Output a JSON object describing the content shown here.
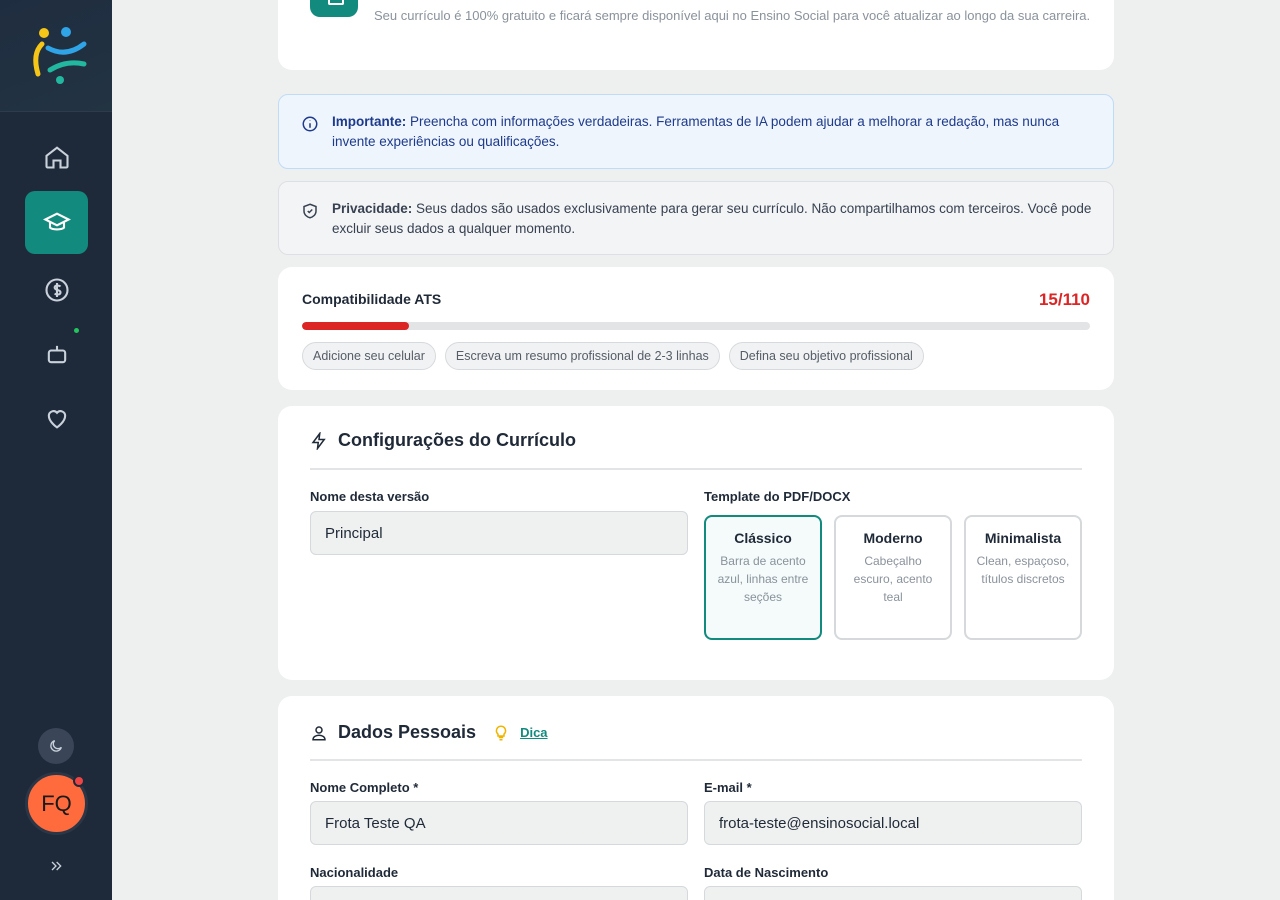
{
  "sidebar": {
    "nav": [
      {
        "icon": "home-icon"
      },
      {
        "icon": "graduation-cap-icon",
        "active": true
      },
      {
        "icon": "dollar-icon"
      },
      {
        "icon": "bot-icon"
      },
      {
        "icon": "heart-icon"
      }
    ],
    "avatar_initials": "FQ",
    "colors": {
      "bg": "#1e2a3a",
      "active": "#138a7e",
      "avatar": "#ff6b3d"
    }
  },
  "intro": {
    "text": "Seu currículo é 100% gratuito e ficará sempre disponível aqui no Ensino Social para você atualizar ao longo da sua carreira."
  },
  "alerts": {
    "important_label": "Importante:",
    "important_text": " Preencha com informações verdadeiras. Ferramentas de IA podem ajudar a melhorar a redação, mas nunca invente experiências ou qualificações.",
    "privacy_label": "Privacidade:",
    "privacy_text": " Seus dados são usados exclusivamente para gerar seu currículo. Não compartilhamos com terceiros. Você pode excluir seus dados a qualquer momento."
  },
  "ats": {
    "title": "Compatibilidade ATS",
    "score_text": "15/110",
    "score": 15,
    "max": 110,
    "suggestions": [
      "Adicione seu celular",
      "Escreva um resumo profissional de 2-3 linhas",
      "Defina seu objetivo profissional"
    ]
  },
  "config": {
    "title": "Configurações do Currículo",
    "version_label": "Nome desta versão",
    "version_value": "Principal",
    "template_label": "Template do PDF/DOCX",
    "templates": [
      {
        "name": "Clássico",
        "desc": "Barra de acento azul, linhas entre seções",
        "selected": true
      },
      {
        "name": "Moderno",
        "desc": "Cabeçalho escuro, acento teal",
        "selected": false
      },
      {
        "name": "Minimalista",
        "desc": "Clean, espaçoso, títulos discretos",
        "selected": false
      }
    ]
  },
  "personal": {
    "title": "Dados Pessoais",
    "tip": "Dica",
    "name_label": "Nome Completo *",
    "name_value": "Frota Teste QA",
    "email_label": "E-mail *",
    "email_value": "frota-teste@ensinosocial.local",
    "nationality_label": "Nacionalidade",
    "birth_label": "Data de Nascimento"
  }
}
